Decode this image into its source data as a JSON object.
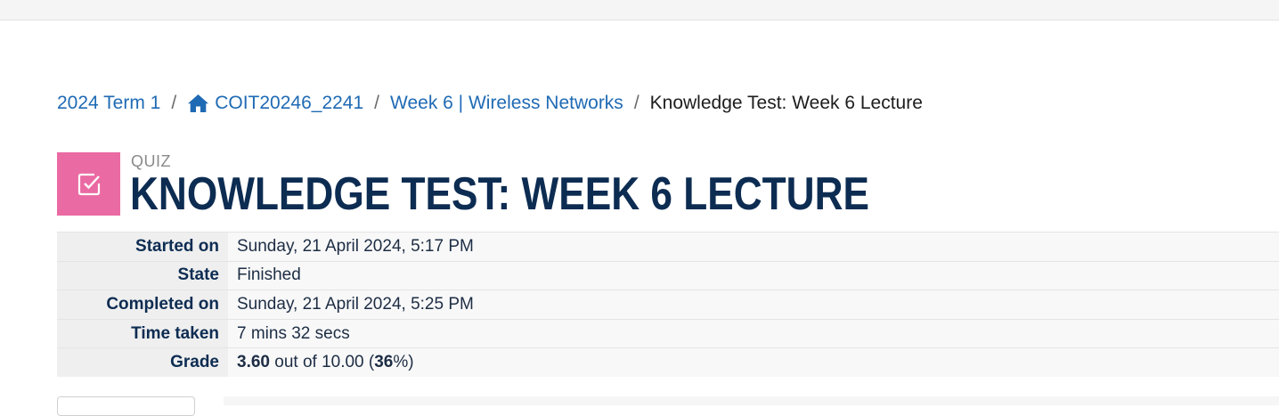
{
  "breadcrumb": {
    "items": [
      {
        "label": "2024 Term 1"
      },
      {
        "label": "COIT20246_2241",
        "icon": "home-icon"
      },
      {
        "label": "Week 6 | Wireless Networks"
      }
    ],
    "current": "Knowledge Test: Week 6 Lecture",
    "separator": "/"
  },
  "header": {
    "modtype": "QUIZ",
    "title": "KNOWLEDGE TEST: WEEK 6 LECTURE",
    "icon": "quiz-checkbox-icon",
    "icon_bg": "#ea6aa3",
    "title_color": "#0d2c52"
  },
  "summary": {
    "started_on_label": "Started on",
    "started_on_value": "Sunday, 21 April 2024, 5:17 PM",
    "state_label": "State",
    "state_value": "Finished",
    "completed_on_label": "Completed on",
    "completed_on_value": "Sunday, 21 April 2024, 5:25 PM",
    "time_taken_label": "Time taken",
    "time_taken_value": "7 mins 32 secs",
    "grade_label": "Grade",
    "grade_score": "3.60",
    "grade_mid": " out of 10.00 (",
    "grade_percent": "36",
    "grade_end": "%)"
  },
  "colors": {
    "link": "#1f6ab4",
    "accent": "#ea6aa3"
  }
}
